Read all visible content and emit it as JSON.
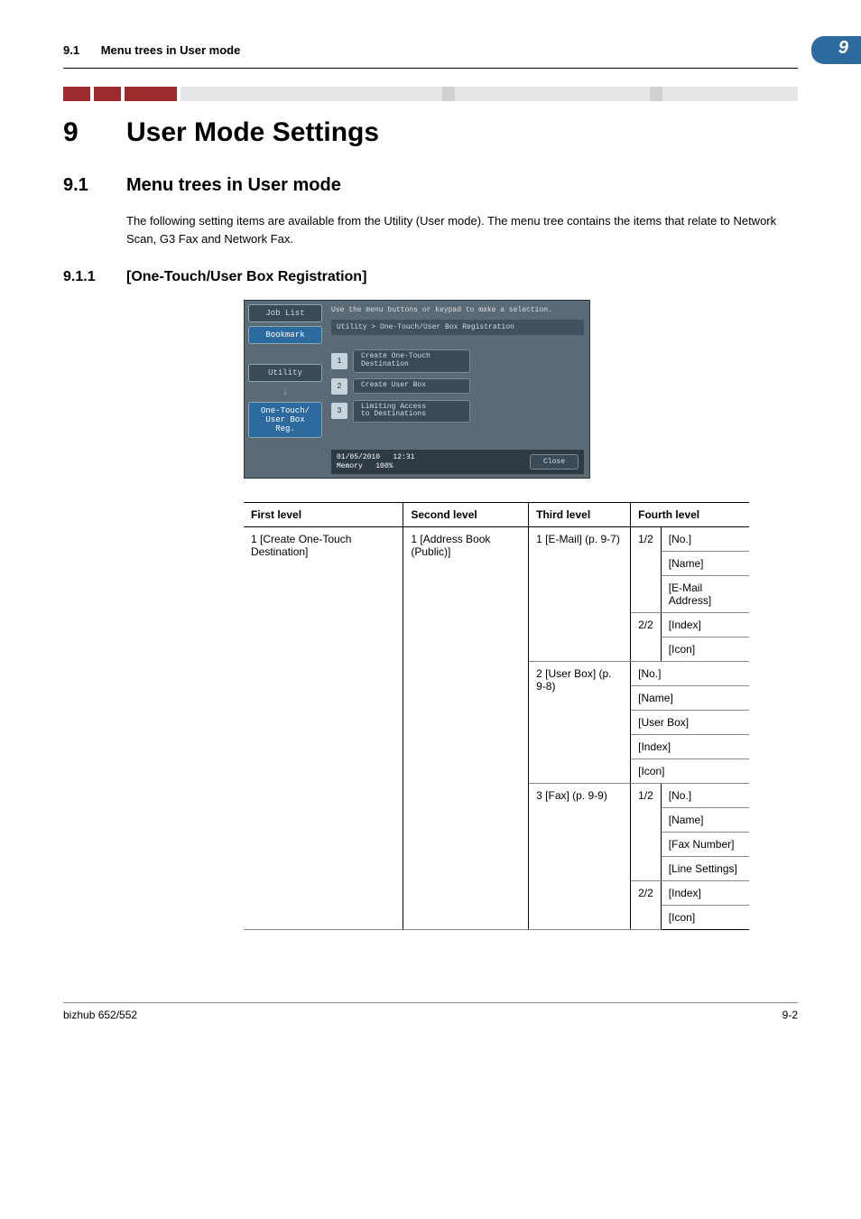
{
  "header": {
    "section_num": "9.1",
    "section_title": "Menu trees in User mode",
    "chapter_badge": "9"
  },
  "chapter": {
    "num": "9",
    "title": "User Mode Settings"
  },
  "section": {
    "num": "9.1",
    "title": "Menu trees in User mode"
  },
  "body1": "The following setting items are available from the Utility (User mode). The menu tree contains the items that relate to Network Scan, G3 Fax and Network Fax.",
  "sub": {
    "num": "9.1.1",
    "title": "[One-Touch/User Box Registration]"
  },
  "shot": {
    "tab_joblist": "Job List",
    "tab_bookmark": "Bookmark",
    "tab_utility": "Utility",
    "tab_reg": "One-Touch/\nUser Box Reg.",
    "arrow": "↓",
    "hint": "Use the menu buttons or keypad to make a selection.",
    "breadcrumb": "Utility > One-Touch/User Box Registration",
    "items": [
      {
        "n": "1",
        "label": "Create One-Touch\nDestination"
      },
      {
        "n": "2",
        "label": "Create User Box"
      },
      {
        "n": "3",
        "label": "Limiting Access\nto Destinations"
      }
    ],
    "date": "01/05/2010",
    "time": "12:31",
    "mem_label": "Memory",
    "mem_val": "100%",
    "close": "Close"
  },
  "table": {
    "headers": [
      "First level",
      "Second level",
      "Third level",
      "Fourth level"
    ],
    "first": "1 [Create One-Touch Destination]",
    "second": "1 [Address Book (Public)]",
    "third1": "1 [E-Mail] (p. 9-7)",
    "third2": "2 [User Box] (p. 9-8)",
    "third3": "3 [Fax] (p. 9-9)",
    "page12_a": "1/2",
    "page22_a": "2/2",
    "page12_b": "1/2",
    "page22_b": "2/2",
    "email_rows": [
      "[No.]",
      "[Name]",
      "[E-Mail Address]",
      "[Index]",
      "[Icon]"
    ],
    "userbox_rows": [
      "[No.]",
      "[Name]",
      "[User Box]",
      "[Index]",
      "[Icon]"
    ],
    "fax_rows": [
      "[No.]",
      "[Name]",
      "[Fax Number]",
      "[Line Settings]",
      "[Index]",
      "[Icon]"
    ]
  },
  "footer": {
    "left": "bizhub 652/552",
    "right": "9-2"
  }
}
